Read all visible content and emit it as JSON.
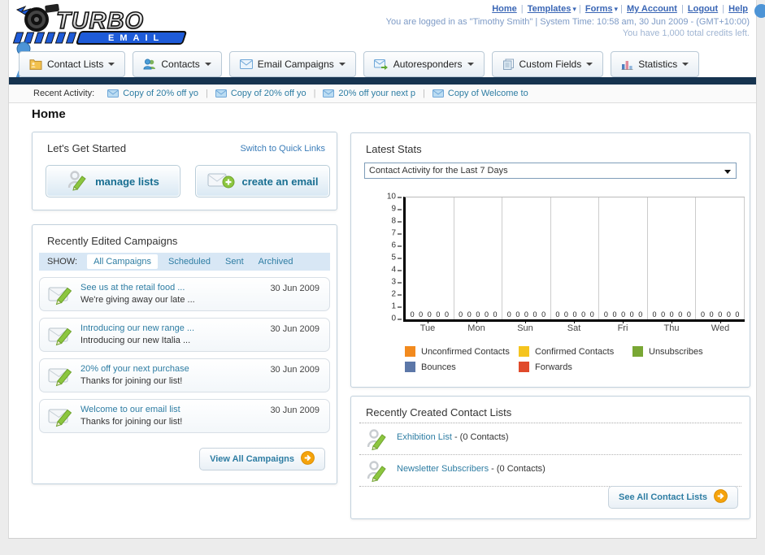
{
  "header": {
    "logo": {
      "title": "TURBO",
      "subtitle": "EMAIL"
    },
    "nav_links": [
      {
        "label": "Home",
        "caret": false
      },
      {
        "label": "Templates",
        "caret": true
      },
      {
        "label": "Forms",
        "caret": true
      },
      {
        "label": "My Account",
        "caret": false
      },
      {
        "label": "Logout",
        "caret": false
      },
      {
        "label": "Help",
        "caret": false
      }
    ],
    "login_line": "You are logged in as \"Timothy Smith\" | System Time: 10:58 am, 30 Jun 2009 - (GMT+10:00)",
    "credits_line": "You have 1,000 total credits left."
  },
  "tabs": [
    {
      "label": "Contact Lists",
      "icon": "contact-lists-icon"
    },
    {
      "label": "Contacts",
      "icon": "contacts-icon"
    },
    {
      "label": "Email Campaigns",
      "icon": "email-campaigns-icon"
    },
    {
      "label": "Autoresponders",
      "icon": "autoresponders-icon"
    },
    {
      "label": "Custom Fields",
      "icon": "custom-fields-icon"
    },
    {
      "label": "Statistics",
      "icon": "statistics-icon"
    }
  ],
  "recent_activity": {
    "label": "Recent Activity:",
    "items": [
      "Copy of 20% off yo",
      "Copy of 20% off yo",
      "20% off your next p",
      "Copy of Welcome to"
    ]
  },
  "page_title": "Home",
  "get_started": {
    "title": "Let's Get Started",
    "switch_link": "Switch to Quick Links",
    "buttons": [
      {
        "label": "manage lists",
        "icon": "person-pencil-icon"
      },
      {
        "label": "create an email",
        "icon": "email-plus-icon"
      }
    ]
  },
  "campaigns": {
    "title": "Recently Edited Campaigns",
    "show_label": "SHOW:",
    "filters": [
      "All Campaigns",
      "Scheduled",
      "Sent",
      "Archived"
    ],
    "active_filter": "All Campaigns",
    "items": [
      {
        "title": "See us at the retail food ...",
        "subtitle": "We're giving away our late ...",
        "date": "30 Jun 2009"
      },
      {
        "title": "Introducing our new range ...",
        "subtitle": "Introducing our new Italia ...",
        "date": "30 Jun 2009"
      },
      {
        "title": "20% off your next purchase",
        "subtitle": "Thanks for joining our list!",
        "date": "30 Jun 2009"
      },
      {
        "title": "Welcome to our email list",
        "subtitle": "Thanks for joining our list!",
        "date": "30 Jun 2009"
      }
    ],
    "view_all_label": "View All Campaigns"
  },
  "latest_stats": {
    "title": "Latest Stats",
    "dropdown_value": "Contact Activity for the Last 7 Days",
    "chart_data": {
      "type": "bar",
      "title": "Contact Activity for the Last 7 Days",
      "categories": [
        "Tue",
        "Mon",
        "Sun",
        "Sat",
        "Fri",
        "Thu",
        "Wed"
      ],
      "series": [
        {
          "name": "Unconfirmed Contacts",
          "color": "#F28A1E",
          "values": [
            0,
            0,
            0,
            0,
            0,
            0,
            0
          ]
        },
        {
          "name": "Confirmed Contacts",
          "color": "#F5C41E",
          "values": [
            0,
            0,
            0,
            0,
            0,
            0,
            0
          ]
        },
        {
          "name": "Unsubscribes",
          "color": "#79A734",
          "values": [
            0,
            0,
            0,
            0,
            0,
            0,
            0
          ]
        },
        {
          "name": "Bounces",
          "color": "#5C77A8",
          "values": [
            0,
            0,
            0,
            0,
            0,
            0,
            0
          ]
        },
        {
          "name": "Forwards",
          "color": "#E04A2B",
          "values": [
            0,
            0,
            0,
            0,
            0,
            0,
            0
          ]
        }
      ],
      "ylim": [
        0,
        10
      ],
      "yticks": [
        0,
        1,
        2,
        3,
        4,
        5,
        6,
        7,
        8,
        9,
        10
      ],
      "grid": "vertical-between-groups",
      "legend_position": "bottom"
    }
  },
  "contact_lists": {
    "title": "Recently Created Contact Lists",
    "items": [
      {
        "name": "Exhibition List",
        "detail": "- (0 Contacts)"
      },
      {
        "name": "Newsletter Subscribers",
        "detail": "- (0 Contacts)"
      }
    ],
    "see_all_label": "See All Contact Lists"
  }
}
